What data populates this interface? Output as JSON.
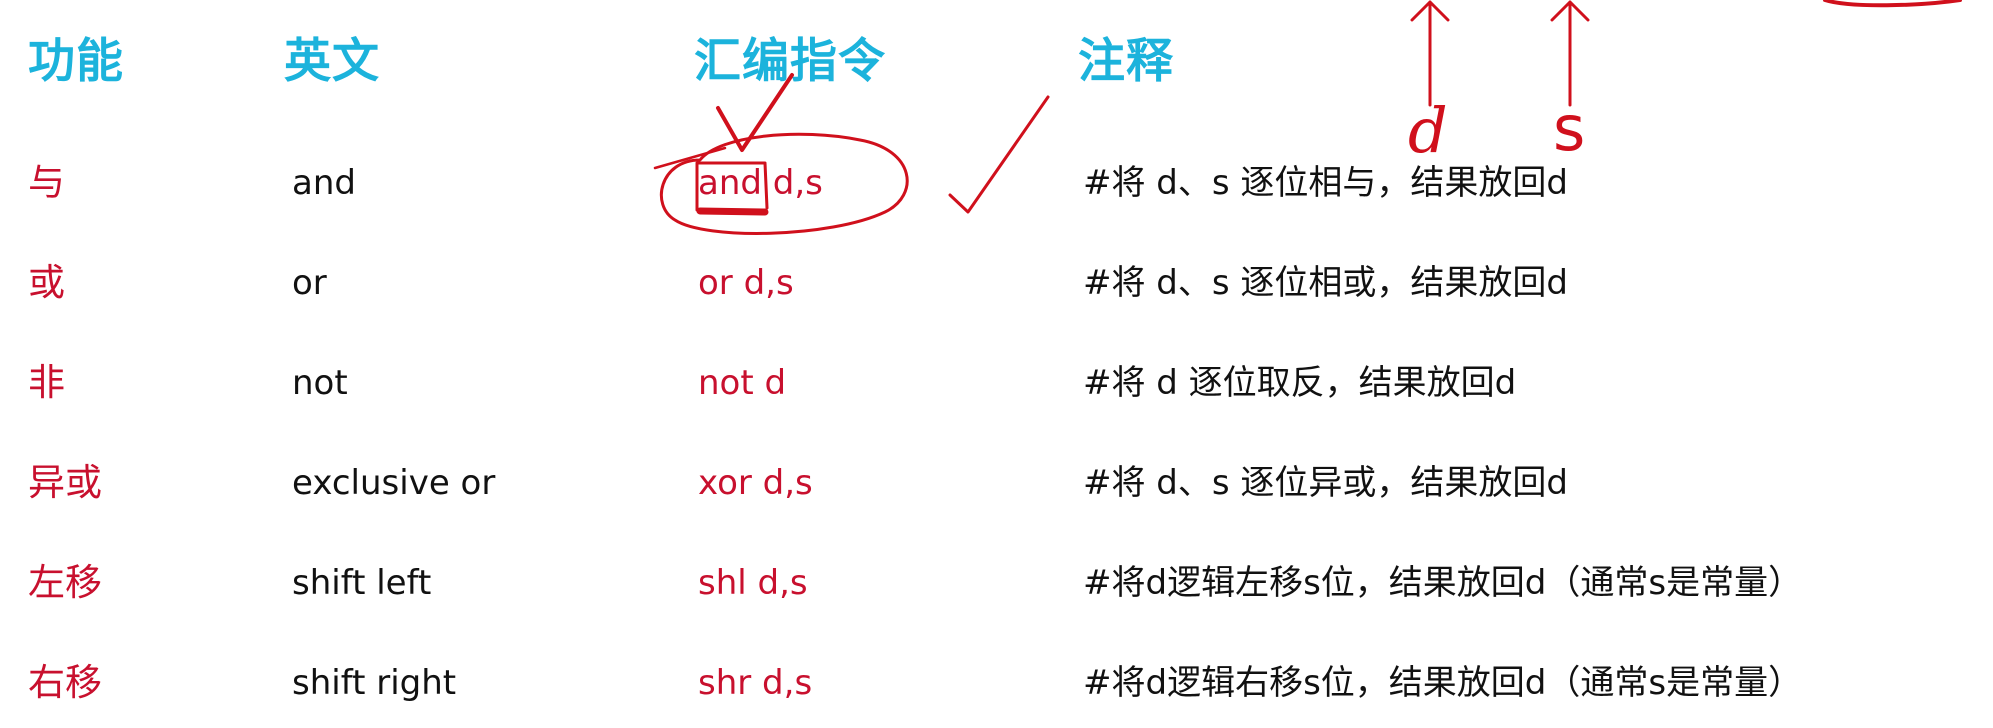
{
  "headers": {
    "function": "功能",
    "english": "英文",
    "assembly": "汇编指令",
    "comment": "注释"
  },
  "rows": [
    {
      "function": "与",
      "english": "and",
      "assembly": "and d,s",
      "comment": "#将 d、s 逐位相与，结果放回d"
    },
    {
      "function": "或",
      "english": "or",
      "assembly": "or d,s",
      "comment": "#将 d、s 逐位相或，结果放回d"
    },
    {
      "function": "非",
      "english": "not",
      "assembly": "not d",
      "comment": "#将 d 逐位取反，结果放回d"
    },
    {
      "function": "异或",
      "english": "exclusive or",
      "assembly": "xor d,s",
      "comment": "#将 d、s 逐位异或，结果放回d"
    },
    {
      "function": "左移",
      "english": "shift left",
      "assembly": "shl d,s",
      "comment": "#将d逻辑左移s位，结果放回d（通常s是常量）"
    },
    {
      "function": "右移",
      "english": "shift right",
      "assembly": "shr d,s",
      "comment": "#将d逻辑右移s位，结果放回d（通常s是常量）"
    }
  ],
  "annotations": {
    "operand_d": "d",
    "operand_s": "s"
  },
  "colors": {
    "header": "#1cb3dc",
    "red_text": "#c8102e",
    "ink": "#d0101c",
    "body_text": "#111111"
  }
}
